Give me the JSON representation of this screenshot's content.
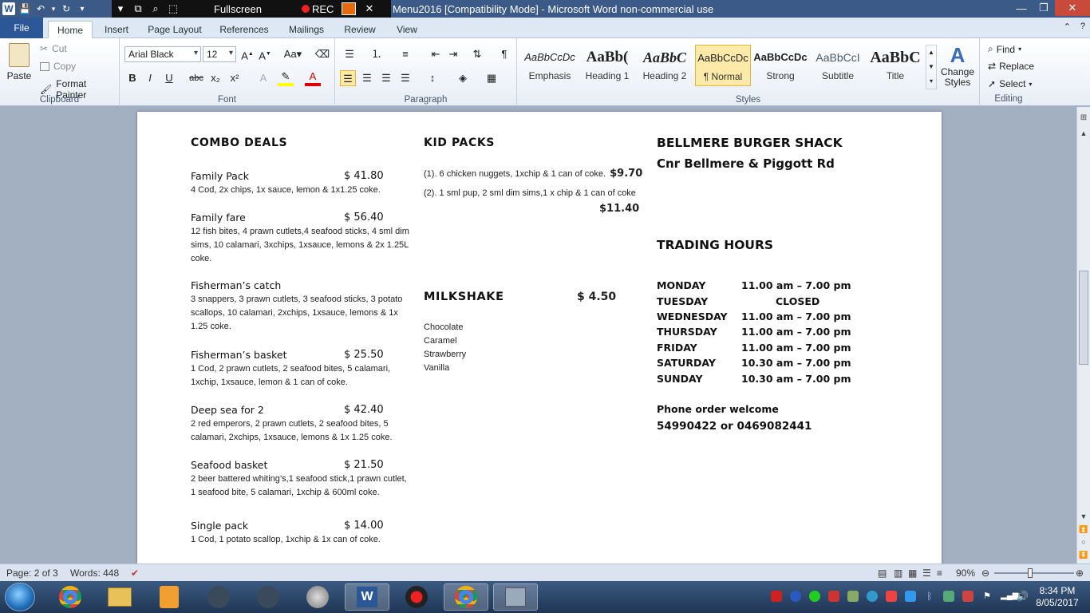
{
  "titlebar": {
    "recorder": {
      "fullscreen_label": "Fullscreen",
      "rec_label": "REC"
    },
    "doc_title": "Menu2016 [Compatibility Mode]  -  Microsoft Word non-commercial use",
    "word_logo": "W",
    "controls": [
      "—",
      "❐",
      "✕"
    ]
  },
  "ribbon_tabs": [
    "File",
    "Home",
    "Insert",
    "Page Layout",
    "References",
    "Mailings",
    "Review",
    "View"
  ],
  "ribbon": {
    "clipboard": {
      "paste": "Paste",
      "cut": "Cut",
      "copy": "Copy",
      "format_painter": "Format Painter",
      "label": "Clipboard"
    },
    "font": {
      "family": "Arial Black",
      "size": "12",
      "label": "Font",
      "buttons": [
        "B",
        "I",
        "U",
        "abc",
        "x₂",
        "x²",
        "A"
      ]
    },
    "paragraph": {
      "label": "Paragraph"
    },
    "styles": {
      "label": "Styles",
      "items": [
        {
          "preview": "AaBbCcDc",
          "name": "Emphasis"
        },
        {
          "preview": "AaBb(",
          "name": "Heading 1"
        },
        {
          "preview": "AaBbC",
          "name": "Heading 2"
        },
        {
          "preview": "AaBbCcDc",
          "name": "¶ Normal"
        },
        {
          "preview": "AaBbCcDc",
          "name": "Strong"
        },
        {
          "preview": "AaBbCcI",
          "name": "Subtitle"
        },
        {
          "preview": "AaBbC",
          "name": "Title"
        }
      ],
      "change_styles": "Change Styles"
    },
    "editing": {
      "find": "Find",
      "replace": "Replace",
      "select": "Select",
      "label": "Editing"
    }
  },
  "document": {
    "combo": {
      "heading": "COMBO DEALS",
      "items": [
        {
          "name": "Family Pack",
          "price": "$ 41.80",
          "desc": "4 Cod, 2x chips, 1x sauce, lemon & 1x1.25 coke."
        },
        {
          "name": "Family fare",
          "price": "$ 56.40",
          "desc": "12 fish bites, 4 prawn cutlets,4 seafood sticks, 4 sml dim sims, 10 calamari, 3xchips, 1xsauce, lemons & 2x 1.25L coke."
        },
        {
          "name": "Fisherman’s catch",
          "price": "",
          "desc": "3 snappers, 3 prawn cutlets, 3 seafood sticks, 3 potato scallops, 10 calamari, 2xchips, 1xsauce, lemons & 1x 1.25 coke."
        },
        {
          "name": "Fisherman’s  basket",
          "price": "$ 25.50",
          "desc": "1 Cod, 2 prawn cutlets, 2 seafood bites, 5 calamari, 1xchip, 1xsauce, lemon & 1 can of coke."
        },
        {
          "name": "Deep sea for 2",
          "price": "$ 42.40",
          "desc": "2 red emperors, 2 prawn cutlets, 2 seafood bites, 5 calamari, 2xchips, 1xsauce, lemons & 1x 1.25 coke."
        },
        {
          "name": "Seafood basket",
          "price": "$ 21.50",
          "desc": "2 beer battered whiting’s,1 seafood stick,1 prawn cutlet, 1 seafood bite, 5 calamari, 1xchip & 600ml coke."
        },
        {
          "name": "Single pack",
          "price": "$ 14.00",
          "desc": "1 Cod, 1 potato scallop, 1xchip & 1x can of coke."
        }
      ]
    },
    "kids": {
      "heading": "KID PACKS",
      "line1": "(1). 6 chicken nuggets, 1xchip & 1 can of coke.",
      "price1": "$9.70",
      "line2": "(2). 1 sml pup, 2 sml dim sims,1 x chip & 1 can of coke",
      "price2": "$11.40"
    },
    "milkshake": {
      "heading": "MILKSHAKE",
      "price": "$ 4.50",
      "flavours": [
        "Chocolate",
        "Caramel",
        "Strawberry",
        "Vanilla"
      ]
    },
    "shop": {
      "name": "BELLMERE BURGER SHACK",
      "address": "Cnr Bellmere & Piggott Rd",
      "hours_heading": "TRADING HOURS",
      "hours": [
        {
          "day": "MONDAY",
          "time": "11.00 am – 7.00 pm"
        },
        {
          "day": "TUESDAY",
          "time": "CLOSED"
        },
        {
          "day": "WEDNESDAY",
          "time": "11.00 am – 7.00 pm"
        },
        {
          "day": "THURSDAY",
          "time": "11.00 am – 7.00 pm"
        },
        {
          "day": "FRIDAY",
          "time": "11.00 am – 7.00 pm"
        },
        {
          "day": "SATURDAY",
          "time": "10.30 am – 7.00 pm"
        },
        {
          "day": "SUNDAY",
          "time": "10.30 am – 7.00 pm"
        }
      ],
      "phone_label": "Phone order welcome",
      "phone_numbers": "54990422 or 0469082441"
    }
  },
  "status": {
    "page": "Page: 2 of 3",
    "words": "Words: 448",
    "zoom": "90%"
  },
  "clock": {
    "time": "8:34 PM",
    "date": "8/05/2017"
  },
  "colors": {
    "title_bar": "#3c5a88",
    "file_tab": "#2b5797",
    "taskbar": "#1f3555"
  }
}
